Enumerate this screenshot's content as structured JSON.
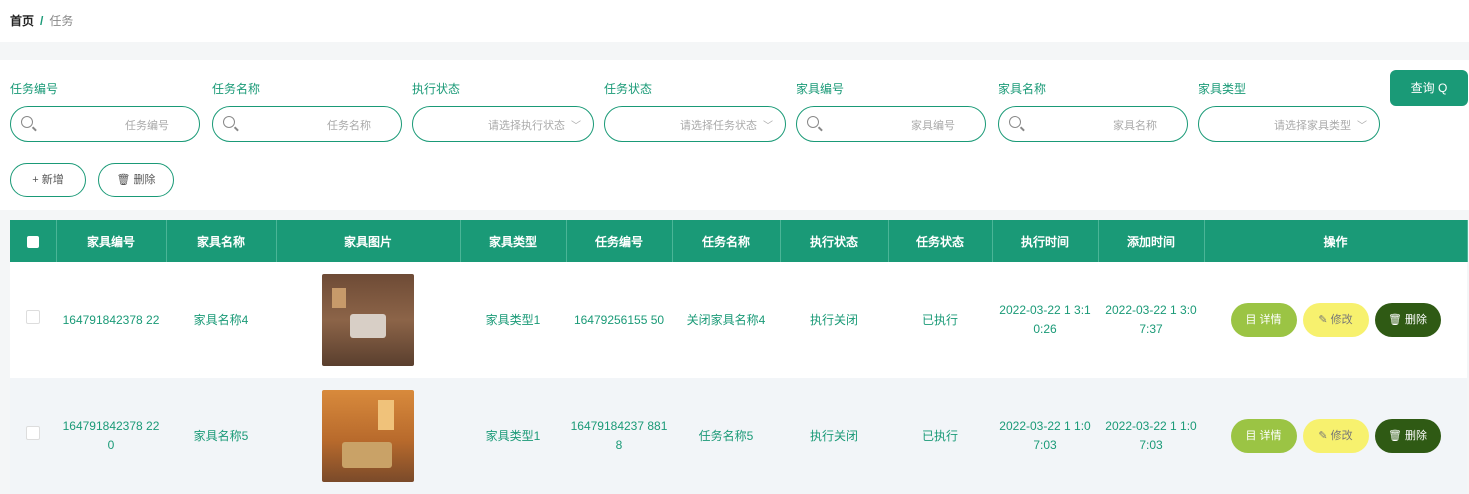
{
  "breadcrumb": {
    "home": "首页",
    "sep": "/",
    "current": "任务"
  },
  "filters": [
    {
      "label": "任务编号",
      "placeholder": "任务编号",
      "type": "input"
    },
    {
      "label": "任务名称",
      "placeholder": "任务名称",
      "type": "input"
    },
    {
      "label": "执行状态",
      "placeholder": "请选择执行状态",
      "type": "select"
    },
    {
      "label": "任务状态",
      "placeholder": "请选择任务状态",
      "type": "select"
    },
    {
      "label": "家具编号",
      "placeholder": "家具编号",
      "type": "input"
    },
    {
      "label": "家具名称",
      "placeholder": "家具名称",
      "type": "input"
    },
    {
      "label": "家具类型",
      "placeholder": "请选择家具类型",
      "type": "select"
    }
  ],
  "search_label": "查询 Q",
  "toolbar": {
    "add_label": "+ 新增",
    "delete_label": "🗑 删除"
  },
  "table": {
    "headers": [
      "家具编号",
      "家具名称",
      "家具图片",
      "家具类型",
      "任务编号",
      "任务名称",
      "执行状态",
      "任务状态",
      "执行时间",
      "添加时间",
      "操作"
    ],
    "rows": [
      {
        "furniture_no": "164791842378 22",
        "furniture_name": "家具名称4",
        "furniture_type": "家具类型1",
        "task_no": "16479256155 50",
        "task_name": "关闭家具名称4",
        "exec_status": "执行关闭",
        "task_status": "已执行",
        "exec_time": "2022-03-22 1 3:10:26",
        "add_time": "2022-03-22 1 3:07:37"
      },
      {
        "furniture_no": "164791842378 220",
        "furniture_name": "家具名称5",
        "furniture_type": "家具类型1",
        "task_no": "16479184237 8818",
        "task_name": "任务名称5",
        "exec_status": "执行关闭",
        "task_status": "已执行",
        "exec_time": "2022-03-22 1 1:07:03",
        "add_time": "2022-03-22 1 1:07:03"
      }
    ],
    "op_labels": {
      "detail": "目 详情",
      "edit": "✎ 修改",
      "delete": "🗑 删除"
    }
  },
  "colors": {
    "primary": "#1a9a77",
    "detail": "#9bc444",
    "edit": "#f7f16e",
    "delete": "#2f5a14"
  }
}
